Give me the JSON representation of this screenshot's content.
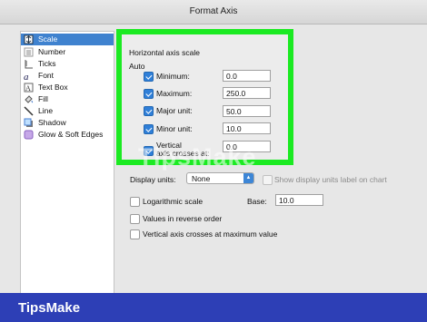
{
  "window": {
    "title": "Format Axis"
  },
  "sidebar": {
    "items": [
      {
        "label": "Scale",
        "icon": "scale-icon",
        "selected": true
      },
      {
        "label": "Number",
        "icon": "number-icon"
      },
      {
        "label": "Ticks",
        "icon": "ticks-icon"
      },
      {
        "label": "Font",
        "icon": "font-icon"
      },
      {
        "label": "Text Box",
        "icon": "text-box-icon"
      },
      {
        "label": "Fill",
        "icon": "fill-icon"
      },
      {
        "label": "Line",
        "icon": "line-icon"
      },
      {
        "label": "Shadow",
        "icon": "shadow-icon"
      },
      {
        "label": "Glow & Soft Edges",
        "icon": "glow-icon"
      }
    ]
  },
  "scale": {
    "heading": "Horizontal axis scale",
    "auto_label": "Auto",
    "rows": [
      {
        "label": "Minimum:",
        "value": "0.0",
        "checked": true
      },
      {
        "label": "Maximum:",
        "value": "250.0",
        "checked": true
      },
      {
        "label": "Major unit:",
        "value": "50.0",
        "checked": true
      },
      {
        "label": "Minor unit:",
        "value": "10.0",
        "checked": true
      },
      {
        "label_line1": "Vertical",
        "label_line2": "axis crosses at:",
        "value": "0.0",
        "checked": true
      }
    ]
  },
  "display_units": {
    "label": "Display units:",
    "value": "None",
    "show_label": "Show display units label on chart"
  },
  "options": {
    "log_scale": "Logarithmic scale",
    "base_label": "Base:",
    "base_value": "10.0",
    "reverse_order": "Values in reverse order",
    "cross_at_max": "Vertical axis crosses at maximum value"
  },
  "watermark": "TipsMake",
  "footer": {
    "brand": "TipsMake"
  },
  "colors": {
    "highlight": "#1bea22",
    "selection": "#3f82cf",
    "footer": "#2d3fb6"
  }
}
